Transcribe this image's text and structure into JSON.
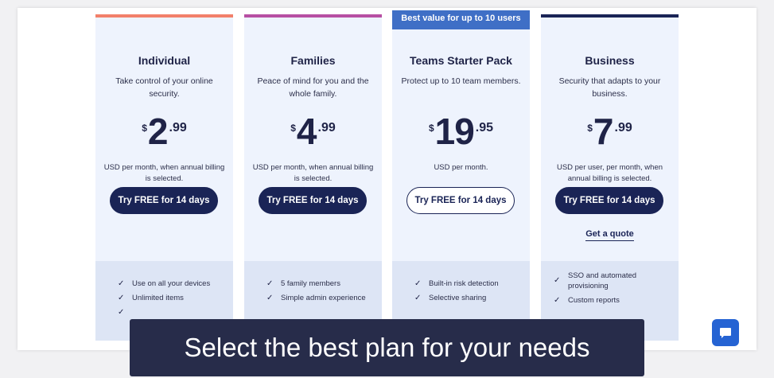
{
  "badge": "Best value for up to 10 users",
  "colors": {
    "individual": "#f2806a",
    "families": "#b74fa3",
    "teams": "#3f6fc6",
    "business": "#1a2456"
  },
  "plans": [
    {
      "title": "Individual",
      "desc": "Take control of your online security.",
      "currency": "$",
      "price": "2",
      "cents": ".99",
      "billing": "USD per month, when annual billing is selected.",
      "cta": "Try FREE for 14 days",
      "features": [
        "Use on all your devices",
        "Unlimited items"
      ]
    },
    {
      "title": "Families",
      "desc": "Peace of mind for you and the whole family.",
      "currency": "$",
      "price": "4",
      "cents": ".99",
      "billing": "USD per month, when annual billing is selected.",
      "cta": "Try FREE for 14 days",
      "features": [
        "5 family members",
        "Simple admin experience"
      ]
    },
    {
      "title": "Teams Starter Pack",
      "desc": "Protect up to 10 team members.",
      "currency": "$",
      "price": "19",
      "cents": ".95",
      "billing": "USD per month.",
      "cta": "Try FREE for 14 days",
      "features": [
        "Built-in risk detection",
        "Selective sharing"
      ]
    },
    {
      "title": "Business",
      "desc": "Security that adapts to your business.",
      "currency": "$",
      "price": "7",
      "cents": ".99",
      "billing": "USD per user, per month, when annual billing is selected.",
      "cta": "Try FREE for 14 days",
      "quote": "Get a quote",
      "features": [
        "SSO and automated provisioning",
        "Custom reports"
      ]
    }
  ],
  "caption": "Select the best plan for your needs",
  "chat_icon": "chat-bubble-icon"
}
